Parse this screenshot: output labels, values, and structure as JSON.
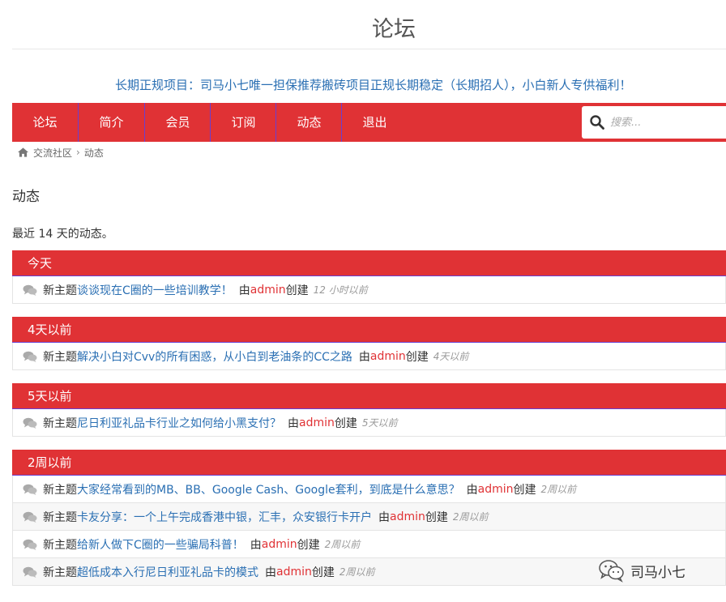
{
  "site": {
    "title": "论坛"
  },
  "promo": "长期正规项目：司马小七唯一担保推荐搬砖项目正规长期稳定（长期招人），小白新人专供福利！",
  "nav": {
    "items": [
      {
        "label": "论坛"
      },
      {
        "label": "简介"
      },
      {
        "label": "会员"
      },
      {
        "label": "订阅"
      },
      {
        "label": "动态"
      },
      {
        "label": "退出"
      }
    ],
    "search_placeholder": "搜索..."
  },
  "breadcrumb": {
    "home": "交流社区",
    "current": "动态"
  },
  "page": {
    "heading": "动态",
    "subtext": "最近 14 天的动态。"
  },
  "sections": [
    {
      "header": "今天",
      "rows": [
        {
          "kind": "新主题",
          "topic": "谈谈现在C圈的一些培训教学！",
          "by": "由",
          "author": "admin",
          "created": "创建",
          "time": "12 小时以前"
        }
      ]
    },
    {
      "header": "4天以前",
      "rows": [
        {
          "kind": "新主题",
          "topic": "解决小白对Cvv的所有困惑，从小白到老油条的CC之路",
          "by": "由",
          "author": "admin",
          "created": "创建",
          "time": "4天以前"
        }
      ]
    },
    {
      "header": "5天以前",
      "rows": [
        {
          "kind": "新主题",
          "topic": "尼日利亚礼品卡行业之如何给小黑支付？",
          "by": "由",
          "author": "admin",
          "created": "创建",
          "time": "5天以前"
        }
      ]
    },
    {
      "header": "2周以前",
      "rows": [
        {
          "kind": "新主题",
          "topic": "大家经常看到的MB、BB、Google Cash、Google套利，到底是什么意思？",
          "by": "由",
          "author": "admin",
          "created": "创建",
          "time": "2周以前"
        },
        {
          "kind": "新主题",
          "topic": "卡友分享：一个上午完成香港中银，汇丰，众安银行卡开户",
          "by": "由",
          "author": "admin",
          "created": "创建",
          "time": "2周以前"
        },
        {
          "kind": "新主题",
          "topic": "给新人做下C圈的一些骗局科普！",
          "by": "由",
          "author": "admin",
          "created": "创建",
          "time": "2周以前"
        },
        {
          "kind": "新主题",
          "topic": "超低成本入行尼日利亚礼品卡的模式",
          "by": "由",
          "author": "admin",
          "created": "创建",
          "time": "2周以前"
        }
      ]
    }
  ],
  "watermark": "司马小七",
  "colors": {
    "brand_red": "#e03235",
    "link_blue": "#2a6fb3",
    "separator_purple": "#6a3fd0"
  }
}
